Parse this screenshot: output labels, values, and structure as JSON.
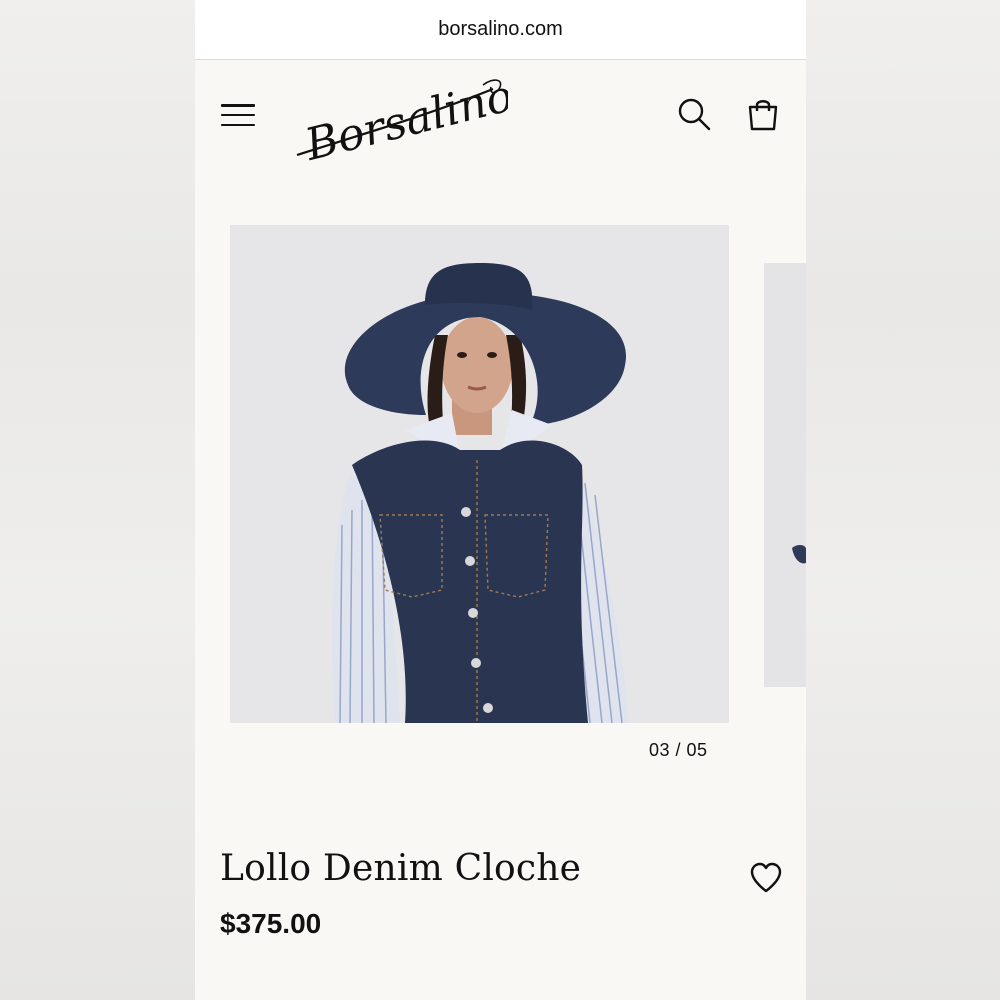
{
  "browser": {
    "url": "borsalino.com"
  },
  "header": {
    "brand": "Borsalino",
    "icons": {
      "menu": "hamburger-menu-icon",
      "search": "search-icon",
      "bag": "shopping-bag-icon"
    }
  },
  "gallery": {
    "current": "03",
    "total": "05",
    "counter_text": "03 / 05"
  },
  "product": {
    "name": "Lollo Denim Cloche",
    "price": "$375.00",
    "wishlist_icon": "heart-icon"
  },
  "colors": {
    "page_bg": "#f9f8f5",
    "text": "#111111",
    "image_bg": "#e6e6e8",
    "denim": "#2a3552"
  }
}
